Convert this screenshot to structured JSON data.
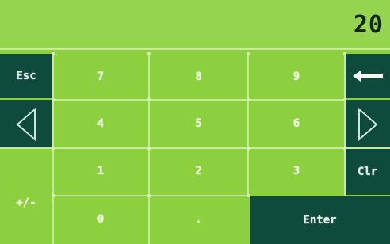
{
  "display": {
    "value": "20"
  },
  "keys": {
    "esc": "Esc",
    "seven": "7",
    "eight": "8",
    "nine": "9",
    "four": "4",
    "five": "5",
    "six": "6",
    "one": "1",
    "two": "2",
    "three": "3",
    "clr": "Clr",
    "plus_minus": "+/-",
    "zero": "0",
    "dot": ".",
    "enter": "Enter"
  },
  "icons": {
    "backspace": "backspace-arrow-icon",
    "left": "left-triangle-icon",
    "right": "right-triangle-icon"
  },
  "colors": {
    "background": "#8ccf3f",
    "dark_key": "#0e4b3d",
    "display_text": "#13251a"
  }
}
